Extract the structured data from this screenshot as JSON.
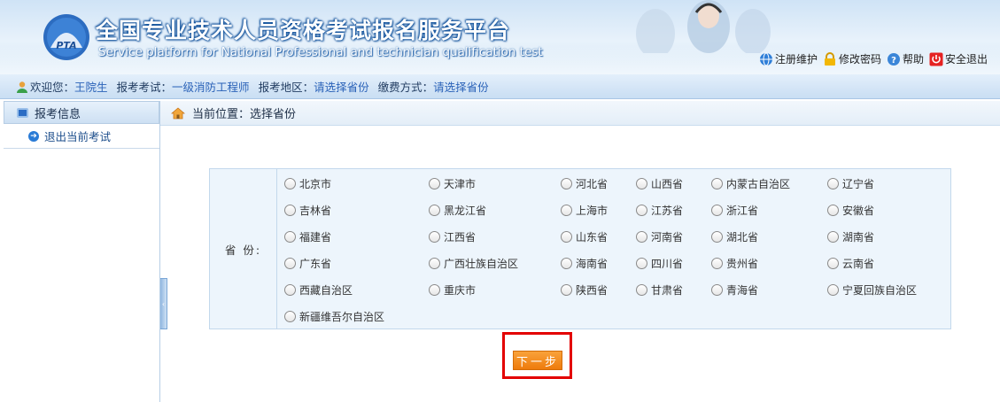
{
  "header": {
    "title_cn": "全国专业技术人员资格考试报名服务平台",
    "title_en": "Service platform for National Professional and technician qualification test",
    "logo_text": "PTA",
    "links": [
      {
        "label": "注册维护",
        "icon": "globe-icon"
      },
      {
        "label": "修改密码",
        "icon": "lock-icon"
      },
      {
        "label": "帮助",
        "icon": "help-icon"
      },
      {
        "label": "安全退出",
        "icon": "power-icon"
      }
    ]
  },
  "infobar": {
    "welcome_label": "欢迎您：",
    "user_name": "王院生",
    "exam_label": "报考考试：",
    "exam_value": "一级消防工程师",
    "region_label": "报考地区：",
    "region_value": "请选择省份",
    "pay_label": "缴费方式：",
    "pay_value": "请选择省份"
  },
  "sidebar": {
    "heading": "报考信息",
    "items": [
      {
        "label": "退出当前考试"
      }
    ]
  },
  "breadcrumb": {
    "text": "当前位置：选择省份"
  },
  "form": {
    "province_label": "省 份:",
    "provinces": [
      "北京市",
      "天津市",
      "河北省",
      "山西省",
      "内蒙古自治区",
      "辽宁省",
      "吉林省",
      "黑龙江省",
      "上海市",
      "江苏省",
      "浙江省",
      "安徽省",
      "福建省",
      "江西省",
      "山东省",
      "河南省",
      "湖北省",
      "湖南省",
      "广东省",
      "广西壮族自治区",
      "海南省",
      "四川省",
      "贵州省",
      "云南省",
      "西藏自治区",
      "重庆市",
      "陕西省",
      "甘肃省",
      "青海省",
      "宁夏回族自治区",
      "新疆维吾尔自治区"
    ],
    "next_label": "下一步"
  },
  "colors": {
    "accent": "#2a62b8",
    "button": "#ee7b0c",
    "highlight": "#e30000"
  }
}
